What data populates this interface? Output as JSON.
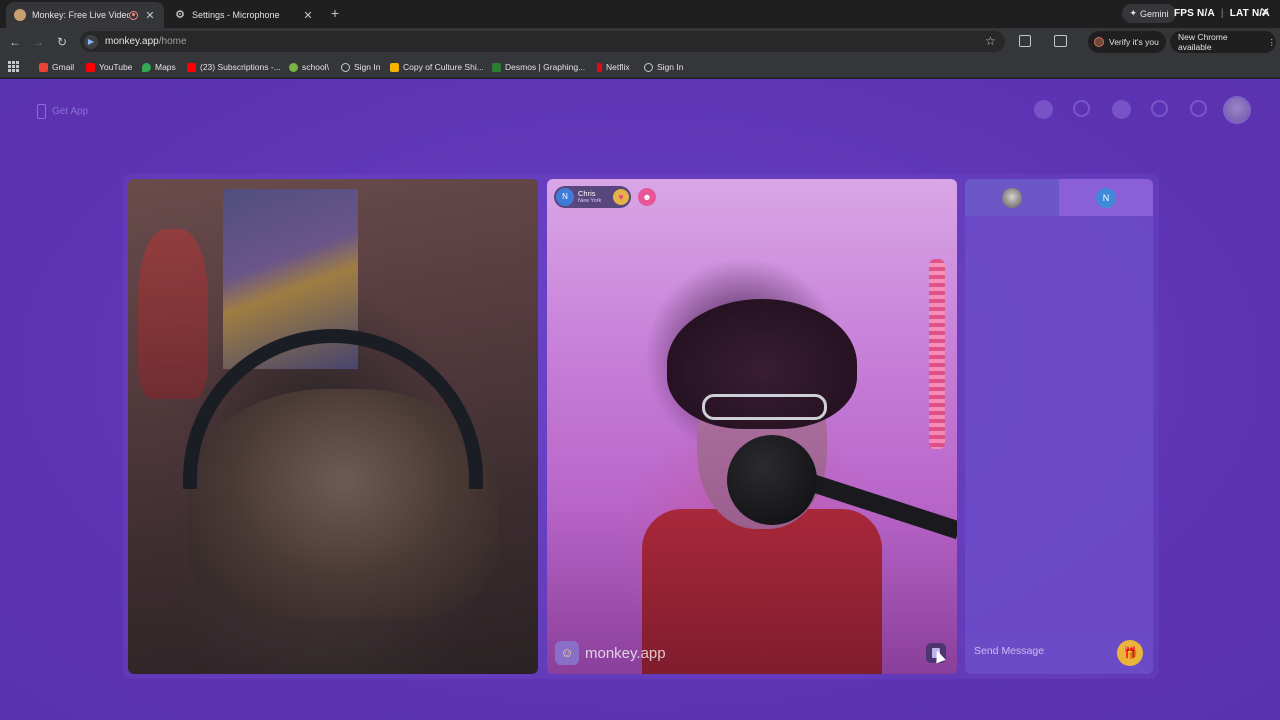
{
  "browser": {
    "tabs": [
      {
        "title": "Monkey: Free Live Video Ch",
        "active": true
      },
      {
        "title": "Settings - Microphone",
        "active": false
      }
    ],
    "gemini_label": "Gemini",
    "stats": {
      "fps_label": "FPS",
      "fps_value": "N/A",
      "lat_label": "LAT",
      "lat_value": "N/A"
    },
    "url_host": "monkey.app",
    "url_path": "/home",
    "verify_label": "Verify it's you",
    "new_chrome_label": "New Chrome available",
    "bookmarks": [
      {
        "label": "Gmail",
        "color": "#ea4335"
      },
      {
        "label": "YouTube",
        "color": "#ff0000"
      },
      {
        "label": "Maps",
        "color": "#34a853"
      },
      {
        "label": "(23) Subscriptions -...",
        "color": "#ff0000"
      },
      {
        "label": "school\\",
        "color": "#7cb342"
      },
      {
        "label": "Sign In",
        "color": "#9aa0a6"
      },
      {
        "label": "Copy of Culture Shi...",
        "color": "#f4b400"
      },
      {
        "label": "Desmos | Graphing...",
        "color": "#2e7d32"
      },
      {
        "label": "Netflix",
        "color": "#e50914"
      },
      {
        "label": "Sign In",
        "color": "#9aa0a6"
      }
    ]
  },
  "page": {
    "get_app_label": "Get App",
    "peer": {
      "initial": "N",
      "name": "Chris",
      "location": "New York"
    },
    "watermark": "monkey.app",
    "chat": {
      "tab_b_initial": "N",
      "placeholder": "Send Message"
    },
    "colors": {
      "page_bg": "#6136b8",
      "accent": "#e8b53a"
    }
  }
}
